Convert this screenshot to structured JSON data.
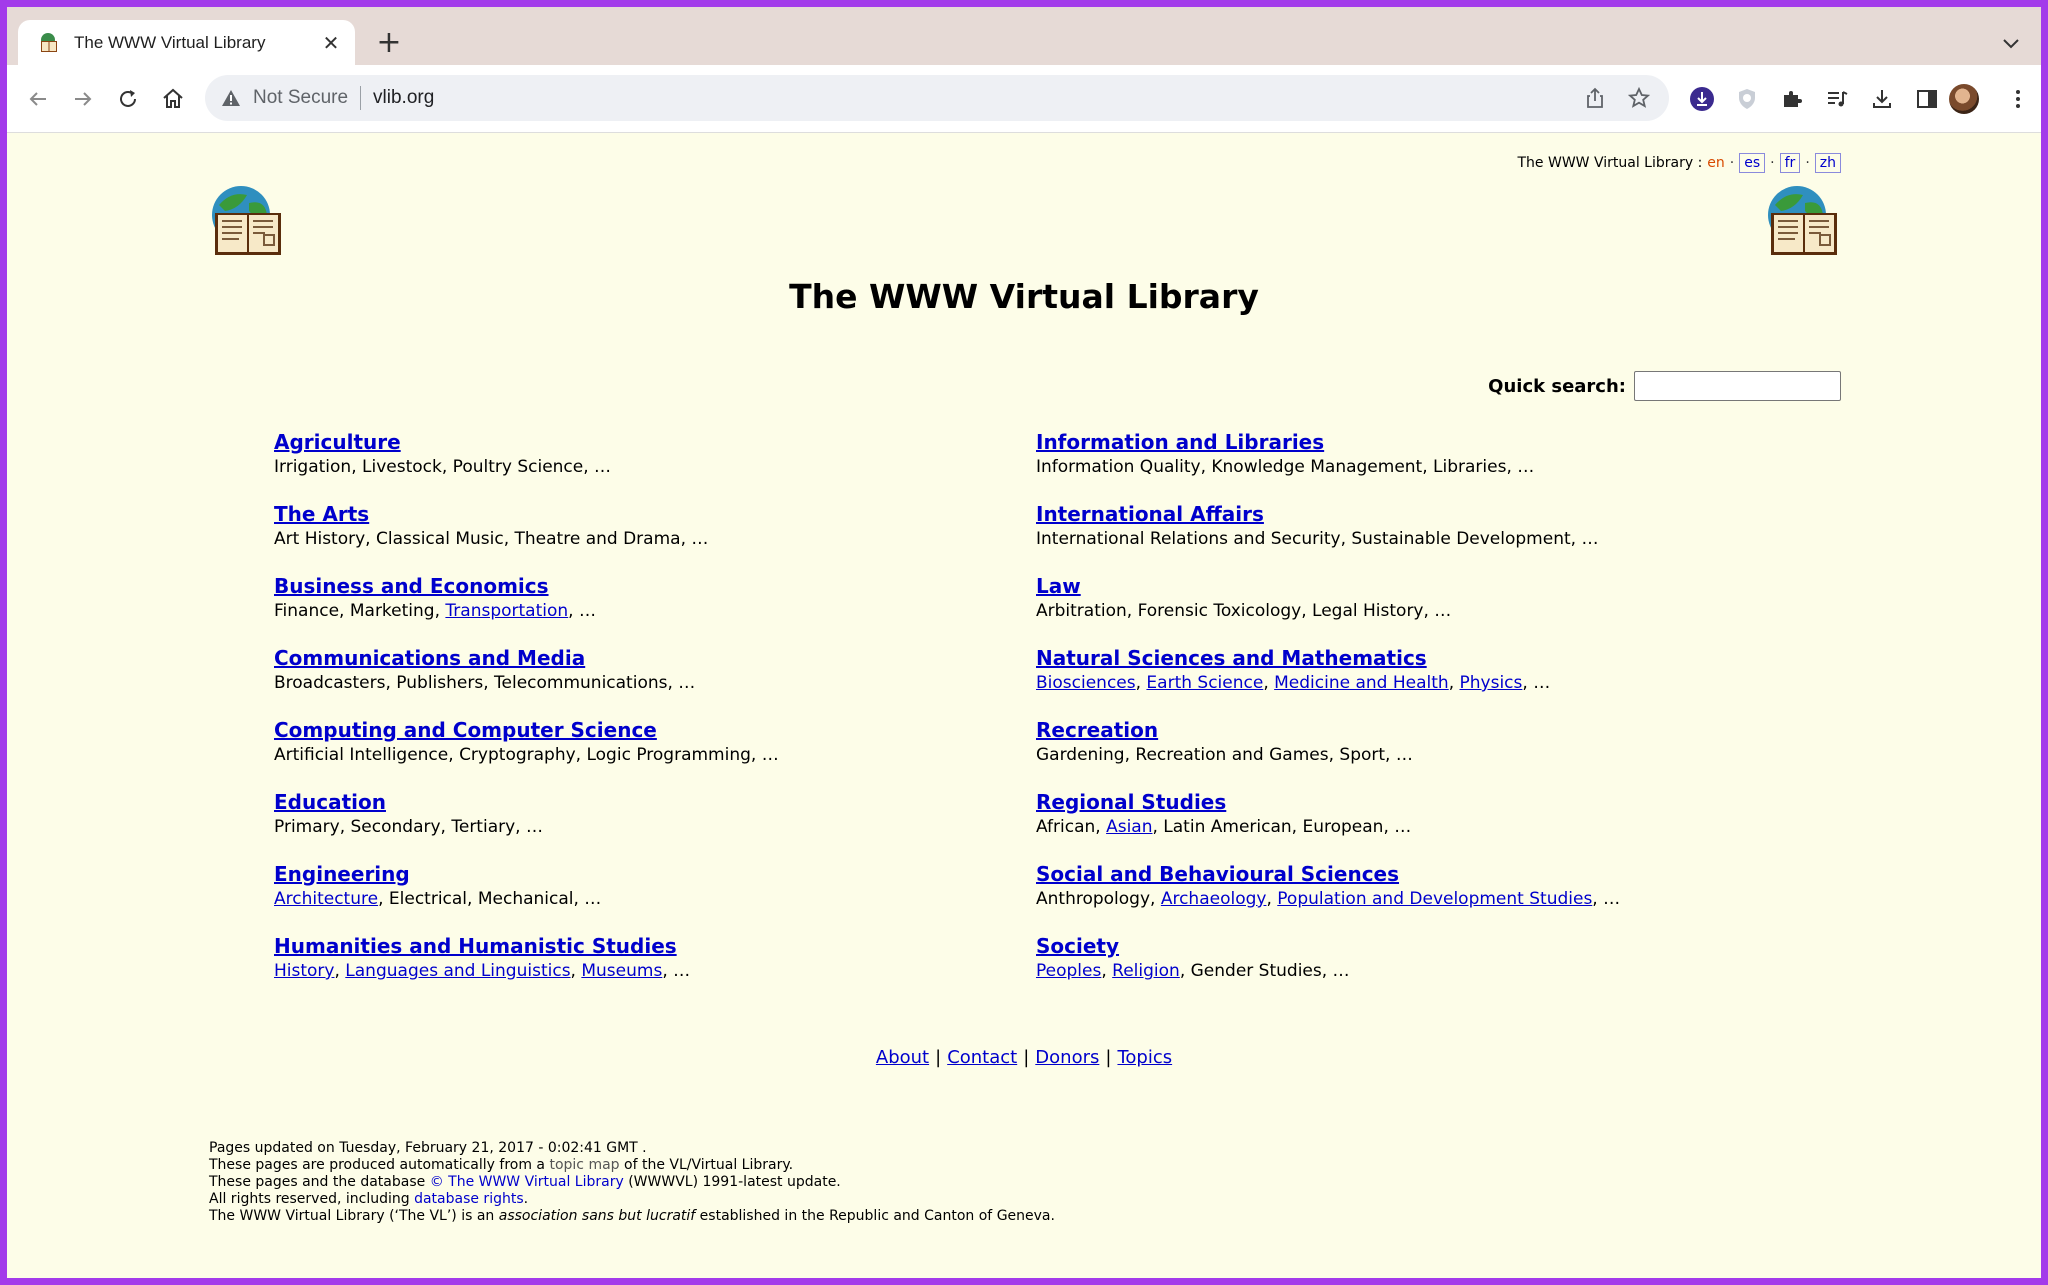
{
  "browser": {
    "tab_title": "The WWW Virtual Library",
    "new_tab": "+",
    "close": "✕",
    "security": "Not Secure",
    "url": "vlib.org"
  },
  "header": {
    "lang_label": "The WWW Virtual Library :",
    "current_lang": "en",
    "langs": [
      "es",
      "fr",
      "zh"
    ],
    "dot": "·"
  },
  "title": "The WWW Virtual Library",
  "search": {
    "label": "Quick search:",
    "value": ""
  },
  "categories_left": [
    {
      "title": "Agriculture",
      "sub": [
        {
          "t": "Irrigation",
          "link": false
        },
        {
          "t": "Livestock",
          "link": false
        },
        {
          "t": "Poultry Science",
          "link": false
        }
      ]
    },
    {
      "title": "The Arts",
      "sub": [
        {
          "t": "Art History",
          "link": false
        },
        {
          "t": "Classical Music",
          "link": false
        },
        {
          "t": "Theatre and Drama",
          "link": false
        }
      ]
    },
    {
      "title": "Business and Economics",
      "sub": [
        {
          "t": "Finance",
          "link": false
        },
        {
          "t": "Marketing",
          "link": false
        },
        {
          "t": "Transportation",
          "link": true
        }
      ]
    },
    {
      "title": "Communications and Media",
      "sub": [
        {
          "t": "Broadcasters",
          "link": false
        },
        {
          "t": "Publishers",
          "link": false
        },
        {
          "t": "Telecommunications",
          "link": false
        }
      ]
    },
    {
      "title": "Computing and Computer Science",
      "sub": [
        {
          "t": "Artificial Intelligence",
          "link": false
        },
        {
          "t": "Cryptography",
          "link": false
        },
        {
          "t": "Logic Programming",
          "link": false
        }
      ]
    },
    {
      "title": "Education",
      "sub": [
        {
          "t": "Primary",
          "link": false
        },
        {
          "t": "Secondary",
          "link": false
        },
        {
          "t": "Tertiary",
          "link": false
        }
      ]
    },
    {
      "title": "Engineering",
      "sub": [
        {
          "t": "Architecture",
          "link": true
        },
        {
          "t": "Electrical",
          "link": false
        },
        {
          "t": "Mechanical",
          "link": false
        }
      ]
    },
    {
      "title": "Humanities and Humanistic Studies",
      "sub": [
        {
          "t": "History",
          "link": true
        },
        {
          "t": "Languages and Linguistics",
          "link": true
        },
        {
          "t": "Museums",
          "link": true
        }
      ]
    }
  ],
  "categories_right": [
    {
      "title": "Information and Libraries",
      "sub": [
        {
          "t": "Information Quality",
          "link": false
        },
        {
          "t": "Knowledge Management",
          "link": false
        },
        {
          "t": "Libraries",
          "link": false
        }
      ]
    },
    {
      "title": "International Affairs",
      "sub": [
        {
          "t": "International Relations and Security",
          "link": false
        },
        {
          "t": "Sustainable Development",
          "link": false
        }
      ]
    },
    {
      "title": "Law",
      "sub": [
        {
          "t": "Arbitration",
          "link": false
        },
        {
          "t": "Forensic Toxicology",
          "link": false
        },
        {
          "t": "Legal History",
          "link": false
        }
      ]
    },
    {
      "title": "Natural Sciences and Mathematics",
      "sub": [
        {
          "t": "Biosciences",
          "link": true
        },
        {
          "t": "Earth Science",
          "link": true
        },
        {
          "t": "Medicine and Health",
          "link": true
        },
        {
          "t": "Physics",
          "link": true
        }
      ]
    },
    {
      "title": "Recreation",
      "sub": [
        {
          "t": "Gardening",
          "link": false
        },
        {
          "t": "Recreation and Games",
          "link": false
        },
        {
          "t": "Sport",
          "link": false
        }
      ]
    },
    {
      "title": "Regional Studies",
      "sub": [
        {
          "t": "African",
          "link": false
        },
        {
          "t": "Asian",
          "link": true
        },
        {
          "t": "Latin American",
          "link": false
        },
        {
          "t": "European",
          "link": false
        }
      ]
    },
    {
      "title": "Social and Behavioural Sciences",
      "sub": [
        {
          "t": "Anthropology",
          "link": false
        },
        {
          "t": "Archaeology",
          "link": true
        },
        {
          "t": "Population and Development Studies",
          "link": true
        }
      ]
    },
    {
      "title": "Society",
      "sub": [
        {
          "t": "Peoples",
          "link": true
        },
        {
          "t": "Religion",
          "link": true
        },
        {
          "t": "Gender Studies",
          "link": false
        }
      ]
    }
  ],
  "sub_separator": ", ",
  "sub_ellipsis": ", …",
  "footer_links": [
    "About",
    "Contact",
    "Donors",
    "Topics"
  ],
  "footer_sep": "|",
  "colophon": {
    "line1": "Pages updated on Tuesday, February 21, 2017 - 0:02:41 GMT .",
    "line2_a": "These pages are produced automatically from a ",
    "line2_link": "topic map",
    "line2_b": " of the VL/Virtual Library.",
    "line3_a": "These pages and the database ",
    "line3_link": "© The WWW Virtual Library",
    "line3_b": " (WWWVL) 1991-latest update.",
    "line4_a": "All rights reserved, including ",
    "line4_link": "database rights",
    "line4_b": ".",
    "line5_a": "The WWW Virtual Library (‘The VL’) is an ",
    "line5_em": "association sans but lucratif",
    "line5_b": " established in the Republic and Canton of Geneva."
  }
}
